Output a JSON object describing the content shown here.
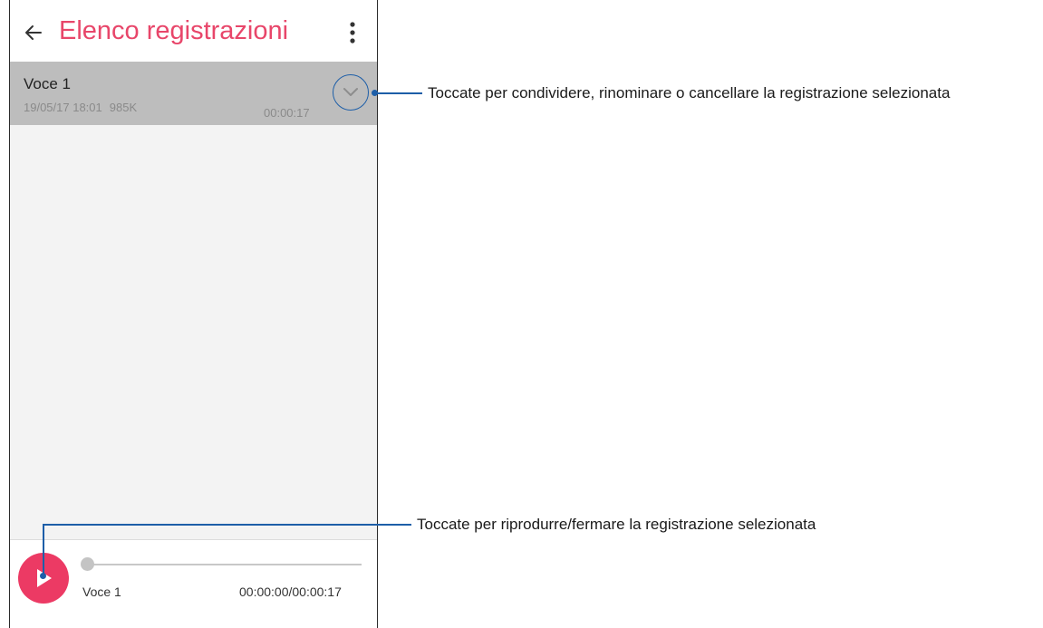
{
  "app": {
    "title": "Elenco registrazioni",
    "accent_color": "#e8466a"
  },
  "icons": {
    "back": "arrow-left-icon",
    "menu": "more-vert-icon",
    "expand": "chevron-down-icon",
    "play": "play-icon"
  },
  "recordings": [
    {
      "name": "Voce 1",
      "date": "19/05/17 18:01",
      "size": "985K",
      "duration": "00:00:17"
    }
  ],
  "player": {
    "track_name": "Voce 1",
    "time": "00:00:00/00:00:17",
    "progress": 0
  },
  "callouts": {
    "options": "Toccate per condividere, rinominare o cancellare la registrazione selezionata",
    "play": "Toccate per riprodurre/fermare la registrazione selezionata",
    "color": "#1d5ea8"
  }
}
